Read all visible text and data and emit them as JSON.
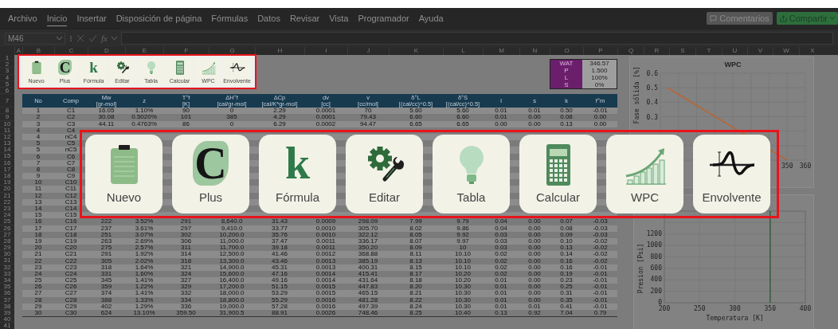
{
  "menu": {
    "tabs": [
      {
        "label": "Archivo",
        "selected": false
      },
      {
        "label": "Inicio",
        "selected": true
      },
      {
        "label": "Insertar",
        "selected": false
      },
      {
        "label": "Disposición de página",
        "selected": false
      },
      {
        "label": "Fórmulas",
        "selected": false
      },
      {
        "label": "Datos",
        "selected": false
      },
      {
        "label": "Revisar",
        "selected": false
      },
      {
        "label": "Vista",
        "selected": false
      },
      {
        "label": "Programador",
        "selected": false
      },
      {
        "label": "Ayuda",
        "selected": false
      }
    ],
    "comments_button": "Comentarios",
    "share_button": "Compartir"
  },
  "formula_bar": {
    "name_box": "M46",
    "fx": "fx"
  },
  "column_headers": [
    "A",
    "B",
    "C",
    "D",
    "E",
    "F",
    "G",
    "H",
    "I",
    "J",
    "K",
    "L",
    "M",
    "N",
    "O",
    "P",
    "Q",
    "R",
    "S",
    "T",
    "U",
    "V",
    "W",
    "X"
  ],
  "row_headers": [
    "1",
    "2",
    "3",
    "4",
    "5",
    "6",
    "7",
    "8",
    "9",
    "10",
    "11",
    "12",
    "13",
    "14",
    "15",
    "16",
    "17",
    "18",
    "19",
    "20",
    "21",
    "22",
    "23",
    "24",
    "25",
    "26",
    "27",
    "28",
    "29",
    "30",
    "31",
    "32",
    "33",
    "34",
    "35",
    "36",
    "37",
    "38",
    "39",
    "40",
    "41"
  ],
  "sheet_toolbar": [
    {
      "label": "Nuevo",
      "kind": "notepad"
    },
    {
      "label": "Plus",
      "kind": "letter",
      "glyph": "C"
    },
    {
      "label": "Fórmula",
      "kind": "letter",
      "glyph": "k"
    },
    {
      "label": "Editar",
      "kind": "gears"
    },
    {
      "label": "Tabla",
      "kind": "bulb"
    },
    {
      "label": "Calcular",
      "kind": "calculator"
    },
    {
      "label": "WPC",
      "kind": "growth"
    },
    {
      "label": "Envolvente",
      "kind": "wave"
    }
  ],
  "summary": [
    {
      "label": "WAT",
      "value": "346.57"
    },
    {
      "label": "P",
      "value": "1.500"
    },
    {
      "label": "L",
      "value": "100%"
    },
    {
      "label": "S",
      "value": "0%"
    }
  ],
  "table": {
    "columns": [
      "No",
      "Comp",
      "Mw\n[gr-mol]",
      "z",
      "T°f\n[K]",
      "ΔH°f\n[cal/gr-mol]",
      "ΔCp\n[cal/K*gr-mol]",
      "dv\n[cc]",
      "v\n[cc/mol]",
      "δ°L\n[(cal/cc)^0.5]",
      "δ°S\n[(cal/cc)^0.5]",
      "l",
      "s",
      "k",
      "f°m"
    ],
    "rows": [
      {
        "cells": [
          "1",
          "C1",
          "16.05",
          "1.10%",
          "90",
          "0",
          "2.29",
          "0.0001",
          "70",
          "5.60",
          "5.60",
          "0.01",
          "0.01",
          "0.50",
          "-0.01"
        ]
      },
      {
        "cells": [
          "2",
          "C2",
          "30.08",
          "0.5020%",
          "101",
          "385",
          "4.29",
          "0.0001",
          "79.43",
          "6.60",
          "6.60",
          "0.01",
          "0.00",
          "0.08",
          "0.00"
        ]
      },
      {
        "cells": [
          "3",
          "C3",
          "44.11",
          "0.4763%",
          "86",
          "0",
          "6.29",
          "0.0002",
          "94.47",
          "6.65",
          "6.65",
          "0.00",
          "0.00",
          "0.13",
          "0.00"
        ]
      },
      {
        "cells": [
          "4",
          "C4"
        ]
      },
      {
        "cells": [
          "4",
          "nC4"
        ]
      },
      {
        "cells": [
          "5",
          "C5"
        ]
      },
      {
        "cells": [
          "5",
          "nC5"
        ]
      },
      {
        "cells": [
          "6",
          "C6"
        ]
      },
      {
        "cells": [
          "7",
          "C7"
        ]
      },
      {
        "cells": [
          "8",
          "C8"
        ]
      },
      {
        "cells": [
          "9",
          "C9"
        ]
      },
      {
        "cells": [
          "10",
          "C10"
        ]
      },
      {
        "cells": [
          "11",
          "C11"
        ]
      },
      {
        "cells": [
          "12",
          "C12"
        ]
      },
      {
        "cells": [
          "13",
          "C13"
        ]
      },
      {
        "cells": [
          "14",
          "C14"
        ]
      },
      {
        "cells": [
          "15",
          "C15"
        ]
      },
      {
        "cells": [
          "16",
          "C16",
          "222",
          "3.52%",
          "291",
          "8,640.0",
          "31.43",
          "0.0009",
          "298.09",
          "7.99",
          "9.79",
          "0.04",
          "0.00",
          "0.07",
          "-0.03"
        ]
      },
      {
        "cells": [
          "17",
          "C17",
          "237",
          "3.61%",
          "297",
          "9,410.0",
          "33.77",
          "0.0010",
          "305.70",
          "8.02",
          "9.86",
          "0.04",
          "0.00",
          "0.08",
          "-0.03"
        ]
      },
      {
        "cells": [
          "18",
          "C18",
          "251",
          "3.07%",
          "302",
          "10,200.0",
          "35.76",
          "0.0010",
          "322.12",
          "8.05",
          "9.92",
          "0.03",
          "0.00",
          "0.09",
          "-0.03"
        ]
      },
      {
        "cells": [
          "19",
          "C19",
          "263",
          "2.69%",
          "306",
          "11,000.0",
          "37.47",
          "0.0011",
          "336.17",
          "8.07",
          "9.97",
          "0.03",
          "0.00",
          "0.10",
          "-0.02"
        ]
      },
      {
        "cells": [
          "20",
          "C20",
          "275",
          "2.57%",
          "311",
          "11,700.0",
          "39.18",
          "0.0011",
          "350.20",
          "8.09",
          "10",
          "0.03",
          "0.00",
          "0.13",
          "-0.02"
        ]
      },
      {
        "cells": [
          "21",
          "C21",
          "291",
          "1.92%",
          "314",
          "12,500.0",
          "41.46",
          "0.0012",
          "368.88",
          "8.11",
          "10.10",
          "0.02",
          "0.00",
          "0.14",
          "-0.02"
        ]
      },
      {
        "cells": [
          "22",
          "C22",
          "305",
          "2.02%",
          "318",
          "13,300.0",
          "43.46",
          "0.0013",
          "385.19",
          "8.13",
          "10.10",
          "0.02",
          "0.00",
          "0.16",
          "-0.02"
        ]
      },
      {
        "cells": [
          "23",
          "C23",
          "318",
          "1.64%",
          "321",
          "14,900.0",
          "45.31",
          "0.0013",
          "400.31",
          "8.15",
          "10.10",
          "0.02",
          "0.00",
          "0.16",
          "-0.01"
        ]
      },
      {
        "cells": [
          "24",
          "C24",
          "331",
          "1.60%",
          "324",
          "15,600.0",
          "47.16",
          "0.0014",
          "415.41",
          "8.17",
          "10.20",
          "0.02",
          "0.00",
          "0.19",
          "-0.01"
        ]
      },
      {
        "cells": [
          "25",
          "C25",
          "345",
          "1.41%",
          "327",
          "16,400.0",
          "49.16",
          "0.0014",
          "431.64",
          "8.18",
          "10.20",
          "0.01",
          "0.00",
          "0.23",
          "-0.01"
        ]
      },
      {
        "cells": [
          "26",
          "C26",
          "359",
          "1.22%",
          "329",
          "17,200.0",
          "51.15",
          "0.0015",
          "447.83",
          "8.20",
          "10.30",
          "0.01",
          "0.00",
          "0.25",
          "-0.01"
        ]
      },
      {
        "cells": [
          "27",
          "C27",
          "374",
          "1.41%",
          "332",
          "18,000.0",
          "53.29",
          "0.0015",
          "465.15",
          "8.21",
          "10.30",
          "0.01",
          "0.00",
          "0.31",
          "-0.01"
        ]
      },
      {
        "cells": [
          "28",
          "C28",
          "388",
          "1.33%",
          "334",
          "18,800.0",
          "55.29",
          "0.0016",
          "481.28",
          "8.22",
          "10.30",
          "0.01",
          "0.00",
          "0.35",
          "-0.01"
        ]
      },
      {
        "cells": [
          "29",
          "C29",
          "402",
          "1.29%",
          "336",
          "19,000.0",
          "57.28",
          "0.0016",
          "497.39",
          "8.24",
          "10.30",
          "0.01",
          "0.01",
          "0.41",
          "-0.01"
        ]
      },
      {
        "cells": [
          "30",
          "C30",
          "624",
          "13.10%",
          "359.50",
          "31,900.5",
          "88.91",
          "0.0026",
          "748.46",
          "8.25",
          "10.40",
          "0.13",
          "0.92",
          "7.04",
          "0.79"
        ]
      }
    ]
  },
  "solid_chart": {
    "title": "WPC",
    "ylabel": "Fase sólida [%]",
    "y_tick_labels": [
      "0.6",
      "0.5",
      "0.4",
      "0.3"
    ],
    "x_tick_labels": [
      "350",
      "360"
    ]
  },
  "charts": [
    {
      "chart_data": {
        "type": "line",
        "grid": true,
        "xlabel": "Temperatura [K]",
        "ylabel": "Presion [Psi]",
        "x": [
          350,
          350
        ],
        "series": [
          {
            "color": "#2e5e3a",
            "values": [
              0,
              1600
            ]
          }
        ],
        "xlim": [
          200,
          400
        ],
        "ylim": [
          0,
          1600
        ],
        "xticks": [
          200,
          250,
          300,
          350,
          400
        ],
        "yticks": [
          0,
          200,
          400,
          600,
          800,
          1000,
          1200
        ]
      }
    }
  ],
  "overlay": {
    "buttons": [
      {
        "label": "Nuevo",
        "kind": "notepad"
      },
      {
        "label": "Plus",
        "kind": "letter",
        "glyph": "C"
      },
      {
        "label": "Fórmula",
        "kind": "letter",
        "glyph": "k"
      },
      {
        "label": "Editar",
        "kind": "gears"
      },
      {
        "label": "Tabla",
        "kind": "bulb"
      },
      {
        "label": "Calcular",
        "kind": "calculator"
      },
      {
        "label": "WPC",
        "kind": "growth"
      },
      {
        "label": "Envolvente",
        "kind": "wave"
      }
    ]
  }
}
